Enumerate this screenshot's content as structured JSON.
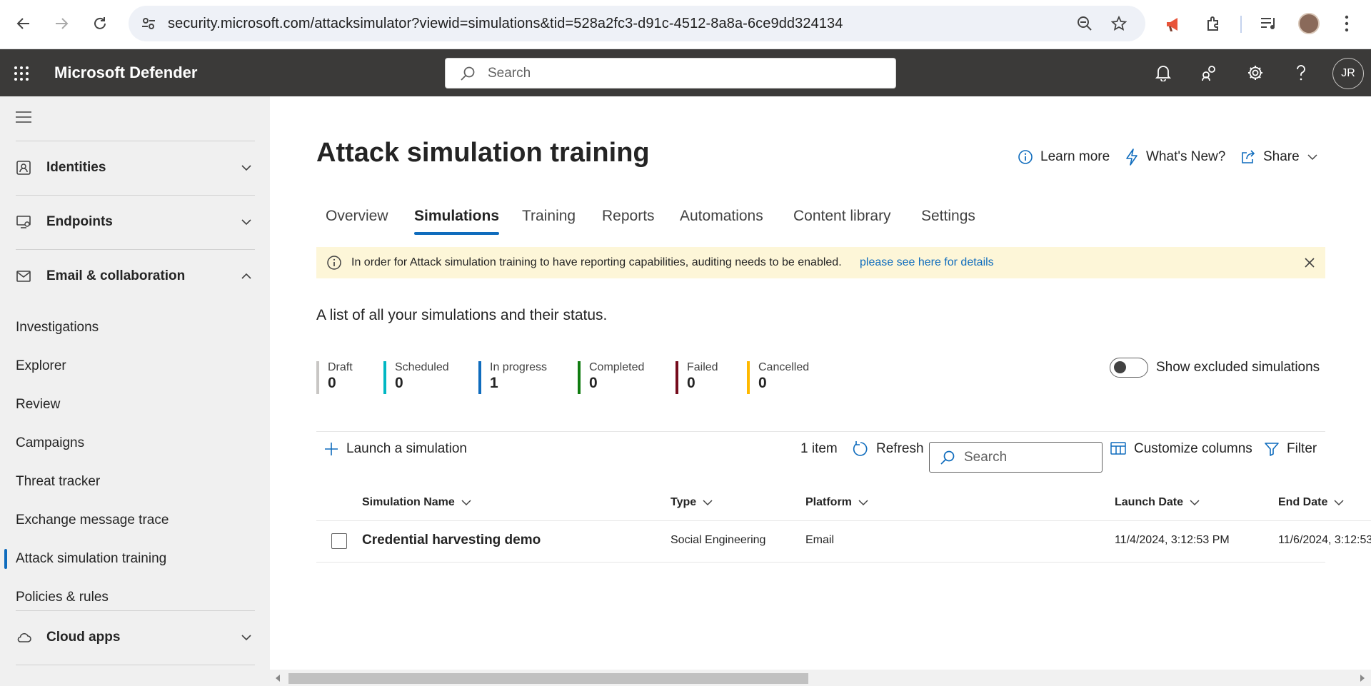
{
  "browser": {
    "url": "security.microsoft.com/attacksimulator?viewid=simulations&tid=528a2fc3-d91c-4512-8a8a-6ce9dd324134"
  },
  "app": {
    "title": "Microsoft Defender",
    "search_placeholder": "Search",
    "avatar_initials": "JR"
  },
  "sidebar": {
    "groups": [
      {
        "label": "Identities",
        "icon": "id-card-icon",
        "expanded": false
      },
      {
        "label": "Endpoints",
        "icon": "device-icon",
        "expanded": false
      },
      {
        "label": "Email & collaboration",
        "icon": "mail-icon",
        "expanded": true
      },
      {
        "label": "Cloud apps",
        "icon": "cloud-icon",
        "expanded": false
      }
    ],
    "items": [
      {
        "label": "Investigations"
      },
      {
        "label": "Explorer"
      },
      {
        "label": "Review"
      },
      {
        "label": "Campaigns"
      },
      {
        "label": "Threat tracker"
      },
      {
        "label": "Exchange message trace"
      },
      {
        "label": "Attack simulation training",
        "active": true
      },
      {
        "label": "Policies & rules"
      }
    ]
  },
  "page": {
    "title": "Attack simulation training",
    "actions": {
      "learn_more": "Learn more",
      "whats_new": "What's New?",
      "share": "Share"
    },
    "tabs": [
      "Overview",
      "Simulations",
      "Training",
      "Reports",
      "Automations",
      "Content library",
      "Settings"
    ],
    "active_tab": "Simulations",
    "banner": {
      "text": "In order for Attack simulation training to have reporting capabilities, auditing needs to be enabled.",
      "link": "please see here for details"
    },
    "description": "A list of all your simulations and their status.",
    "stats": [
      {
        "label": "Draft",
        "value": "0",
        "color": "#c8c6c4"
      },
      {
        "label": "Scheduled",
        "value": "0",
        "color": "#00b7c3"
      },
      {
        "label": "In progress",
        "value": "1",
        "color": "#0f6cbd"
      },
      {
        "label": "Completed",
        "value": "0",
        "color": "#107c10"
      },
      {
        "label": "Failed",
        "value": "0",
        "color": "#750b1c"
      },
      {
        "label": "Cancelled",
        "value": "0",
        "color": "#ffb900"
      }
    ],
    "toggle_label": "Show excluded simulations",
    "commands": {
      "launch": "Launch a simulation",
      "item_count": "1 item",
      "refresh": "Refresh",
      "search_placeholder": "Search",
      "customize": "Customize columns",
      "filter": "Filter"
    },
    "table": {
      "columns": [
        "Simulation Name",
        "Type",
        "Platform",
        "Launch Date",
        "End Date"
      ],
      "rows": [
        {
          "name": "Credential harvesting demo",
          "type": "Social Engineering",
          "platform": "Email",
          "launch_date": "11/4/2024, 3:12:53 PM",
          "end_date": "11/6/2024, 3:12:53"
        }
      ]
    }
  }
}
